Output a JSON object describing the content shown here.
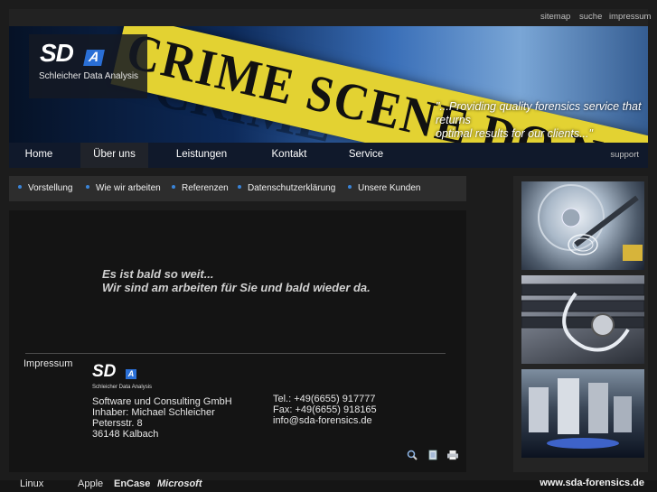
{
  "top_links": [
    "sitemap",
    "suche",
    "impressum"
  ],
  "hero": {
    "logo_main": "SD",
    "logo_accent": "A",
    "logo_sub": "Schleicher Data Analysis",
    "tape_text": "CRIME SCENE DO NOT CROSS",
    "ghost_text": "CRIME",
    "quote_line1": "\"...Providing quality forensics service that returns",
    "quote_line2": "optimal results for our clients...\""
  },
  "main_nav": [
    "Home",
    "Über uns",
    "Leistungen",
    "Kontakt",
    "Service"
  ],
  "support_label": "support",
  "sub_nav": [
    "Vorstellung",
    "Wie wir arbeiten",
    "Referenzen",
    "Datenschutzerklärung",
    "Unsere Kunden"
  ],
  "content": {
    "message_line1": "Es ist bald so weit...",
    "message_line2": "Wir sind am arbeiten für Sie und bald wieder da.",
    "impressum_label": "Impressum",
    "small_logo_main": "SD",
    "small_logo_accent": "A",
    "small_logo_sub": "Schleicher Data Analysis",
    "company": "Software  und Consulting GmbH",
    "owner": "Inhaber: Michael Schleicher",
    "street": "Petersstr. 8",
    "city": "36148 Kalbach",
    "tel": "Tel.: +49(6655) 917777",
    "fax": "Fax: +49(6655) 918165",
    "email": "info@sda-forensics.de"
  },
  "tool_icons": [
    "zoom-icon",
    "document-icon",
    "print-icon"
  ],
  "footer": {
    "brands": [
      "Linux",
      "Apple",
      "EnCase",
      "Microsoft"
    ],
    "url": "www.sda-forensics.de"
  },
  "colors": {
    "accent_blue": "#2a6fd6",
    "tape_yellow": "#e3d232",
    "background": "#1c1c1c"
  }
}
